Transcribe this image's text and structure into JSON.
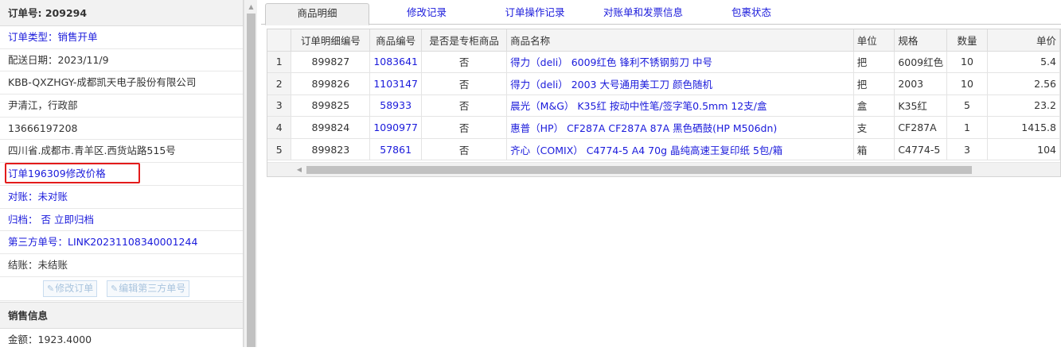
{
  "left": {
    "order_label": "订单号:",
    "order_no": "209294",
    "rows": [
      {
        "text": "订单类型：销售开单",
        "blue": true
      },
      {
        "text": "配送日期：2023/11/9",
        "blue": false
      },
      {
        "text": "KBB-QXZHGY-成都凯天电子股份有限公司",
        "blue": false
      },
      {
        "text": "尹清江，行政部",
        "blue": false
      },
      {
        "text": "13666197208",
        "blue": false
      },
      {
        "text": "四川省.成都市.青羊区.西货站路515号",
        "blue": false
      },
      {
        "text": "订单196309修改价格",
        "blue": true,
        "highlight": true
      },
      {
        "text": "对账：未对账",
        "blue": true
      },
      {
        "text": "归档：  否 立即归档",
        "blue": true
      },
      {
        "text": "第三方单号：LINK20231108340001244",
        "blue": true
      },
      {
        "text": "结账：未结账",
        "blue": false
      }
    ],
    "buttons": {
      "modify_order": "修改订单",
      "edit_third_party": "编辑第三方单号"
    },
    "sales_header": "销售信息",
    "amount": "金额：1923.4000"
  },
  "tabs": [
    {
      "label": "商品明细",
      "active": true
    },
    {
      "label": "修改记录",
      "active": false
    },
    {
      "label": "订单操作记录",
      "active": false
    },
    {
      "label": "对账单和发票信息",
      "active": false
    },
    {
      "label": "包裹状态",
      "active": false
    }
  ],
  "table": {
    "columns": [
      "",
      "订单明细编号",
      "商品编号",
      "是否是专柜商品",
      "商品名称",
      "单位",
      "规格",
      "数量",
      "单价"
    ],
    "rows": [
      {
        "rn": "1",
        "detail_id": "899827",
        "product_id": "1083641",
        "counter": "否",
        "name": "得力（deli） 6009红色 锋利不锈钢剪刀 中号",
        "unit": "把",
        "spec": "6009红色",
        "qty": "10",
        "price": "5.4"
      },
      {
        "rn": "2",
        "detail_id": "899826",
        "product_id": "1103147",
        "counter": "否",
        "name": "得力（deli） 2003 大号通用美工刀 颜色随机",
        "unit": "把",
        "spec": "2003",
        "qty": "10",
        "price": "2.56"
      },
      {
        "rn": "3",
        "detail_id": "899825",
        "product_id": "58933",
        "counter": "否",
        "name": "晨光（M&G） K35红 按动中性笔/签字笔0.5mm 12支/盒",
        "unit": "盒",
        "spec": "K35红",
        "qty": "5",
        "price": "23.2"
      },
      {
        "rn": "4",
        "detail_id": "899824",
        "product_id": "1090977",
        "counter": "否",
        "name": "惠普（HP） CF287A CF287A 87A 黑色硒鼓(HP M506dn)",
        "unit": "支",
        "spec": "CF287A",
        "qty": "1",
        "price": "1415.8"
      },
      {
        "rn": "5",
        "detail_id": "899823",
        "product_id": "57861",
        "counter": "否",
        "name": "齐心（COMIX） C4774-5 A4 70g 晶纯高速王复印纸 5包/箱",
        "unit": "箱",
        "spec": "C4774-5",
        "qty": "3",
        "price": "104"
      }
    ]
  },
  "colors": {
    "link": "#1a1adb",
    "highlight_border": "#e31b1b"
  }
}
